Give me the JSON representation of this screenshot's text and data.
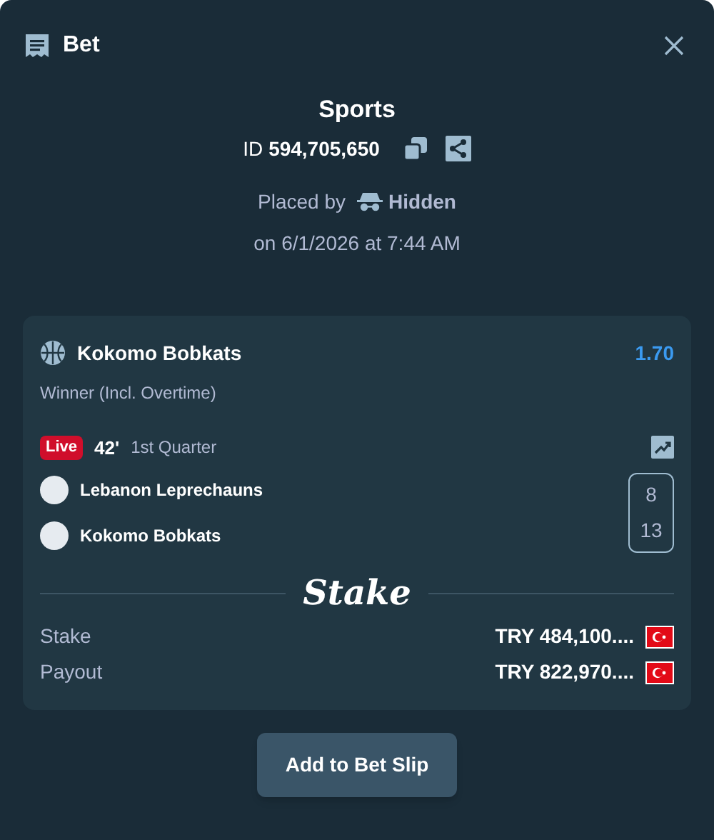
{
  "header": {
    "title": "Bet"
  },
  "summary": {
    "category": "Sports",
    "id_label": "ID",
    "id_value": "594,705,650",
    "placed_by_label": "Placed by",
    "placed_by_user": "Hidden",
    "placed_on": "on 6/1/2026 at 7:44 AM"
  },
  "selection": {
    "team": "Kokomo Bobkats",
    "odds": "1.70",
    "market": "Winner (Incl. Overtime)",
    "live_badge": "Live",
    "time": "42'",
    "period": "1st Quarter",
    "teams": [
      {
        "name": "Lebanon Leprechauns",
        "score": "8"
      },
      {
        "name": "Kokomo Bobkats",
        "score": "13"
      }
    ]
  },
  "logo": "Stake",
  "amounts": [
    {
      "label": "Stake",
      "value": "TRY 484,100...."
    },
    {
      "label": "Payout",
      "value": "TRY 822,970...."
    }
  ],
  "button": "Add to Bet Slip"
}
